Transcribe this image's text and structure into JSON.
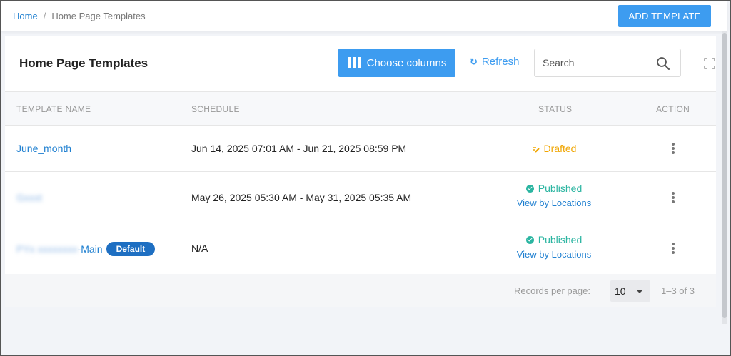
{
  "breadcrumb": {
    "home": "Home",
    "separator": "/",
    "current": "Home Page Templates"
  },
  "header": {
    "add_button": "ADD TEMPLATE"
  },
  "card": {
    "title": "Home Page Templates",
    "choose_columns": "Choose columns",
    "refresh": "Refresh",
    "search_placeholder": "Search"
  },
  "table": {
    "columns": [
      "TEMPLATE NAME",
      "SCHEDULE",
      "STATUS",
      "ACTION"
    ],
    "rows": [
      {
        "name": "June_month",
        "schedule": "Jun 14, 2025 07:01 AM - Jun 21, 2025 08:59 PM",
        "status": "Drafted",
        "view_link": ""
      },
      {
        "name": "Gxxxt",
        "schedule": "May 26, 2025 05:30 AM - May 31, 2025 05:35 AM",
        "status": "Published",
        "view_link": "View by Locations"
      },
      {
        "name_blurred": "PYx xxxxxxxx",
        "name_suffix": "-Main",
        "badge": "Default",
        "schedule": "N/A",
        "status": "Published",
        "view_link": "View by Locations"
      }
    ]
  },
  "footer": {
    "records_label": "Records per page:",
    "records_value": "10",
    "range": "1–3 of 3"
  },
  "colors": {
    "primary": "#3d9cf0",
    "link": "#1e7fd0",
    "drafted": "#f0a500",
    "published": "#2bb5a1",
    "badge": "#1e6fc2"
  }
}
